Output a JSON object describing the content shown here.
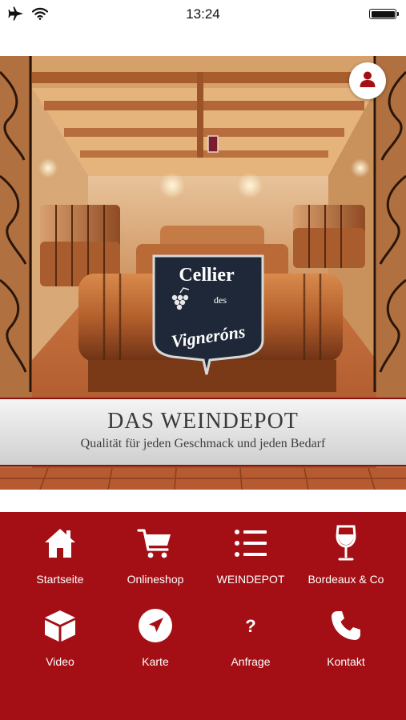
{
  "status_bar": {
    "time": "13:24",
    "icons": [
      "airplane-icon",
      "wifi-icon",
      "battery-icon"
    ]
  },
  "hero": {
    "logo": {
      "line1": "Cellier",
      "line2": "des",
      "line3": "Vigneróns"
    },
    "banner_title": "DAS WEINDEPOT",
    "banner_subtitle": "Qualität für jeden Geschmack und jeden Bedarf",
    "profile_icon": "user-icon"
  },
  "menu": {
    "items": [
      {
        "label": "Startseite",
        "icon": "home-icon"
      },
      {
        "label": "Onlineshop",
        "icon": "cart-icon"
      },
      {
        "label": "WEINDEPOT",
        "icon": "list-icon"
      },
      {
        "label": "Bordeaux & Co",
        "icon": "wine-glass-icon"
      },
      {
        "label": "Video",
        "icon": "cube-icon"
      },
      {
        "label": "Karte",
        "icon": "navigation-icon"
      },
      {
        "label": "Anfrage",
        "icon": "question-icon"
      },
      {
        "label": "Kontakt",
        "icon": "phone-icon"
      }
    ]
  },
  "colors": {
    "menu_background": "#a30f14",
    "banner_border": "#8a1212",
    "accent": "#a30f14"
  }
}
